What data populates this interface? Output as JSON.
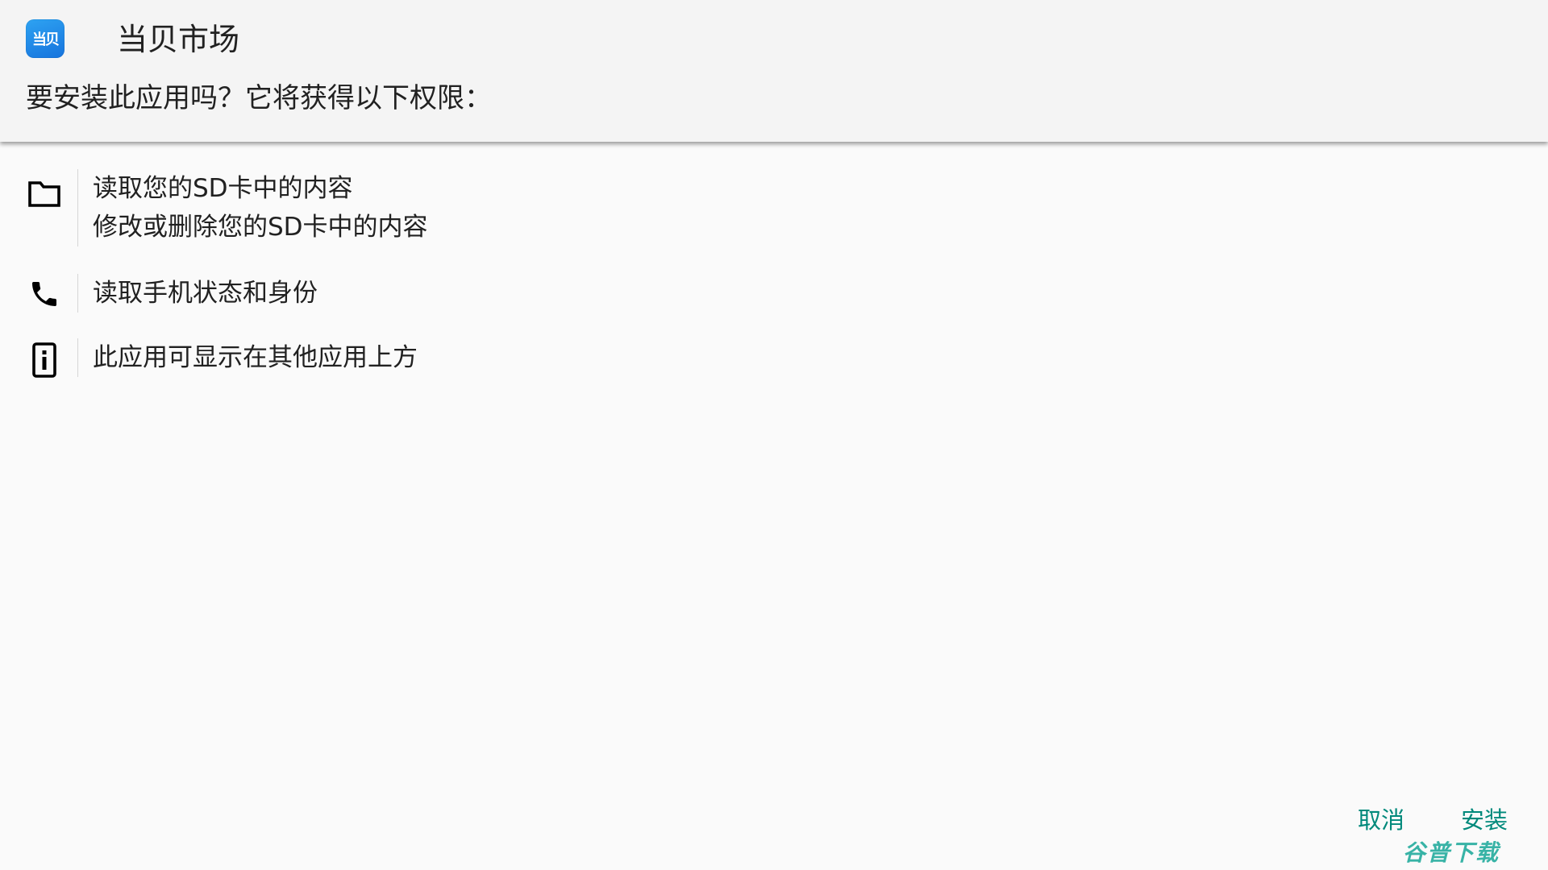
{
  "header": {
    "app_icon_text": "当贝",
    "app_name": "当贝市场",
    "install_question": "要安装此应用吗？它将获得以下权限："
  },
  "permissions": [
    {
      "icon": "folder-icon",
      "lines": [
        "读取您的SD卡中的内容",
        "修改或删除您的SD卡中的内容"
      ]
    },
    {
      "icon": "phone-icon",
      "lines": [
        "读取手机状态和身份"
      ]
    },
    {
      "icon": "overlay-window-icon",
      "lines": [
        "此应用可显示在其他应用上方"
      ]
    }
  ],
  "buttons": {
    "cancel": "取消",
    "install": "安装"
  },
  "watermark": "谷普下载",
  "colors": {
    "accent": "#00897b",
    "header_bg": "#f4f4f4",
    "page_bg": "#fafafa"
  }
}
